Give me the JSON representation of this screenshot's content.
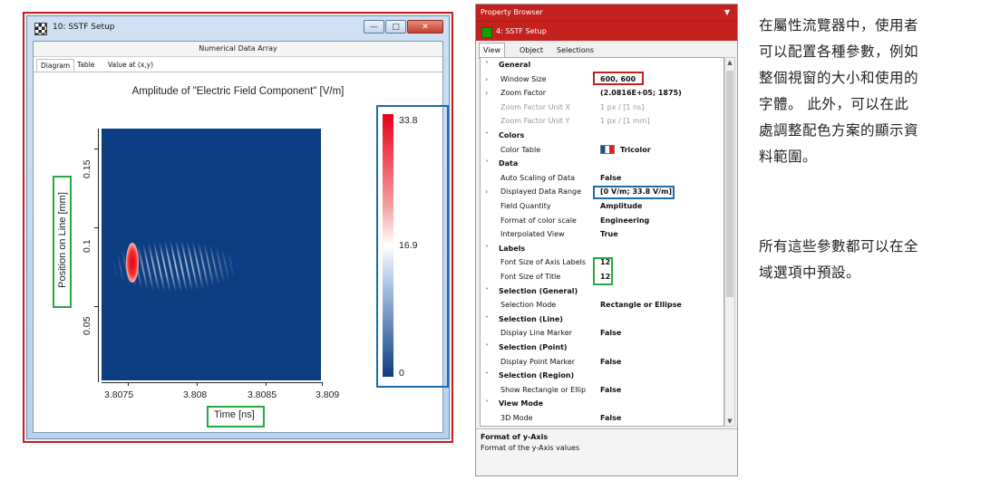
{
  "left_window": {
    "title": "10: SSTF Setup",
    "section": "Numerical Data Array",
    "tabs": [
      "Diagram",
      "Table",
      "Value at (x,y)"
    ],
    "plot_title": "Amplitude of \"Electric Field Component\"  [V/m]",
    "ylabel": "Position on Line [mm]",
    "xlabel": "Time [ns]",
    "xticks": [
      "3.8075",
      "3.808",
      "3.8085",
      "3.809"
    ],
    "yticks": [
      "0.05",
      "0.1",
      "0.15"
    ],
    "colorbar": {
      "max": "33.8",
      "mid": "16.9",
      "min": "0",
      "colors": [
        "#e8001a",
        "#ffffff",
        "#0d3d82"
      ]
    }
  },
  "property_browser": {
    "header": "Property Browser",
    "pin_icon": "pin-icon",
    "subject": "4: SSTF Setup",
    "tabs": [
      "View",
      "Object",
      "Selections"
    ],
    "rows": [
      {
        "type": "cat",
        "label": "General"
      },
      {
        "type": "prop",
        "label": "Window Size",
        "value": "600, 600",
        "expand": true
      },
      {
        "type": "prop",
        "label": "Zoom Factor",
        "value": "(2.0816E+05; 1875)",
        "expand": true
      },
      {
        "type": "prop",
        "label": "Zoom Factor Unit X",
        "value": "1 px / [1 ns]",
        "dim": true
      },
      {
        "type": "prop",
        "label": "Zoom Factor Unit Y",
        "value": "1 px / [1 mm]",
        "dim": true
      },
      {
        "type": "cat",
        "label": "Colors"
      },
      {
        "type": "prop",
        "label": "Color Table",
        "value": "Tricolor",
        "swatch": true
      },
      {
        "type": "cat",
        "label": "Data"
      },
      {
        "type": "prop",
        "label": "Auto Scaling of Data",
        "value": "False"
      },
      {
        "type": "prop",
        "label": "Displayed Data Range",
        "value": "[0 V/m; 33.8 V/m]",
        "expand": true
      },
      {
        "type": "prop",
        "label": "Field Quantity",
        "value": "Amplitude"
      },
      {
        "type": "prop",
        "label": "Format of color scale",
        "value": "Engineering"
      },
      {
        "type": "prop",
        "label": "Interpolated View",
        "value": "True"
      },
      {
        "type": "cat",
        "label": "Labels"
      },
      {
        "type": "prop",
        "label": "Font Size of Axis Labels",
        "value": "12"
      },
      {
        "type": "prop",
        "label": "Font Size of Title",
        "value": "12"
      },
      {
        "type": "cat",
        "label": "Selection (General)"
      },
      {
        "type": "prop",
        "label": "Selection Mode",
        "value": "Rectangle or Ellipse"
      },
      {
        "type": "cat",
        "label": "Selection (Line)"
      },
      {
        "type": "prop",
        "label": "Display Line Marker",
        "value": "False"
      },
      {
        "type": "cat",
        "label": "Selection (Point)"
      },
      {
        "type": "prop",
        "label": "Display Point Marker",
        "value": "False"
      },
      {
        "type": "cat",
        "label": "Selection (Region)"
      },
      {
        "type": "prop",
        "label": "Show Rectangle or Ellip",
        "value": "False"
      },
      {
        "type": "cat",
        "label": "View Mode"
      },
      {
        "type": "prop",
        "label": "3D Mode",
        "value": "False"
      }
    ],
    "desc_title": "Format of y-Axis",
    "desc_text": "Format of the y-Axis values"
  },
  "explanation": {
    "p1": [
      "在屬性流覽器中，使用者",
      "可以配置各種參數，例如",
      "整個視窗的大小和使用的",
      "字體。  此外，可以在此",
      "處調整配色方案的顯示資",
      "料範圍。"
    ],
    "p2": [
      "所有這些參數都可以在全",
      "域選項中預設。"
    ]
  },
  "highlight_colors": {
    "red": "#c4211f",
    "green": "#27a844",
    "blue": "#1b6ea5"
  }
}
